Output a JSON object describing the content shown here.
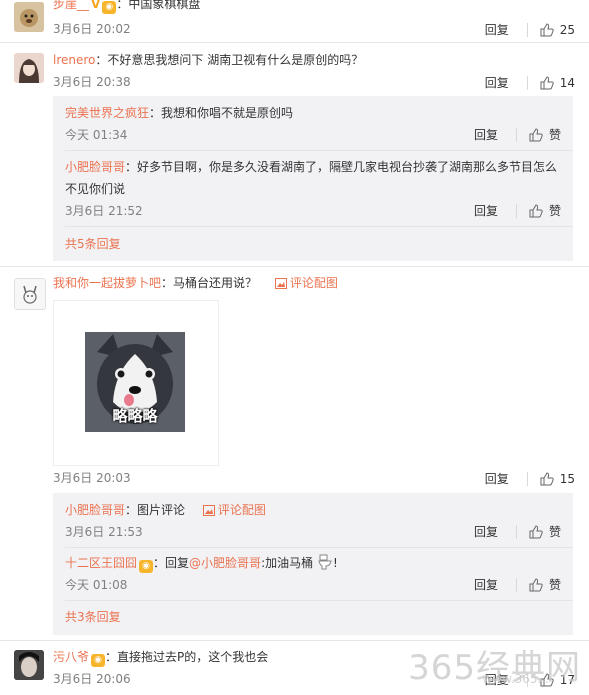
{
  "comments": [
    {
      "user": "步崖__",
      "sep": "：",
      "text": "中国象棋棋盘",
      "time": "3月6日 20:02",
      "reply_label": "回复",
      "likes": "25"
    },
    {
      "user": "lrenero",
      "sep": "：",
      "text": "不好意思我想问下 湖南卫视有什么是原创的吗？",
      "time": "3月6日 20:38",
      "reply_label": "回复",
      "likes": "14",
      "replies": [
        {
          "user": "完美世界之疯狂",
          "sep": "：",
          "text": "我想和你唱不就是原创吗",
          "time": "今天 01:34",
          "reply_label": "回复",
          "like_label": "赞"
        },
        {
          "user": "小肥脸哥哥",
          "sep": "：",
          "text": "好多节目啊，你是多久没看湖南了，隔壁几家电视台抄袭了湖南那么多节目怎么",
          "text2": "不见你们说",
          "time": "3月6日 21:52",
          "reply_label": "回复",
          "like_label": "赞"
        }
      ],
      "total_replies": "共5条回复"
    },
    {
      "user": "我和你一起拔萝卜吧",
      "sep": "：",
      "text": "马桶台还用说？",
      "pic_link": "评论配图",
      "image_caption": "略略略",
      "time": "3月6日 20:03",
      "reply_label": "回复",
      "likes": "15",
      "replies": [
        {
          "user": "小肥脸哥哥",
          "sep": "：",
          "text": "图片评论",
          "pic_link": "评论配图",
          "time": "3月6日 21:53",
          "reply_label": "回复",
          "like_label": "赞"
        },
        {
          "user": "十二区王囧囧",
          "sep": "：",
          "reply_prefix": "回复",
          "mention": "@小肥脸哥哥",
          "text": ":加油马桶",
          "text_end": "!",
          "time": "今天 01:08",
          "reply_label": "回复",
          "like_label": "赞"
        }
      ],
      "total_replies": "共3条回复"
    },
    {
      "user": "污八爷",
      "sep": "：",
      "text": "直接拖过去P的，这个我也会",
      "time": "3月6日 20:06",
      "reply_label": "回复",
      "likes": "17"
    }
  ],
  "watermark": {
    "main": "365经典网",
    "sub": "www.365..."
  },
  "colors": {
    "username": "#eb7350",
    "reply_bg": "#f2f2f5",
    "text": "#333333",
    "time": "#808080"
  }
}
